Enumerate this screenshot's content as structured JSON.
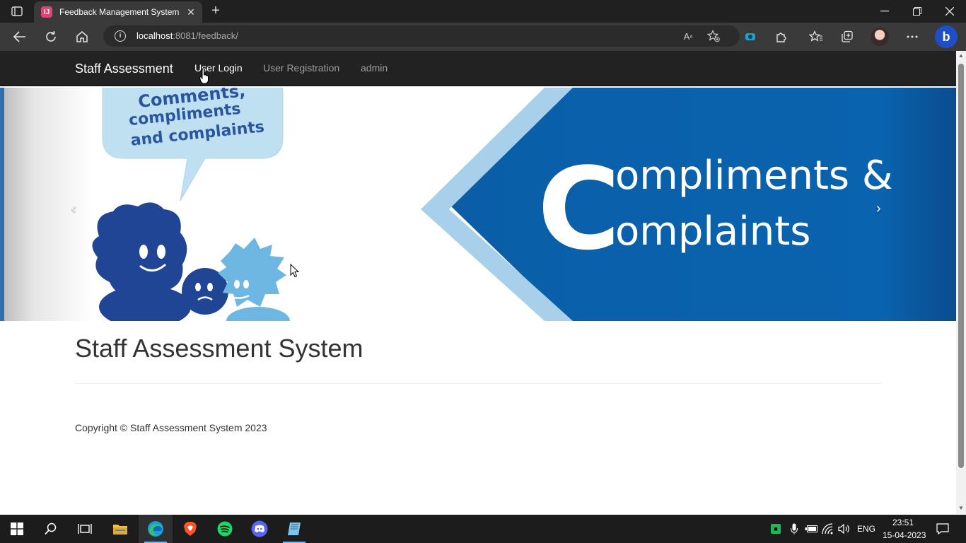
{
  "browser": {
    "tab_title": "Feedback Management System",
    "url_host": "localhost",
    "url_rest": ":8081/feedback/"
  },
  "navbar": {
    "brand": "Staff Assessment",
    "links": [
      "User Login",
      "User Registration",
      "admin"
    ]
  },
  "carousel": {
    "speech_bubble": [
      "Comments,",
      "compliments",
      "and complaints"
    ],
    "banner_line1": "ompliments &",
    "banner_line2": "omplaints",
    "banner_big_letter": "C",
    "prev_label": "‹",
    "next_label": "›"
  },
  "main": {
    "heading": "Staff Assessment System",
    "footer": "Copyright © Staff Assessment System 2023"
  },
  "taskbar": {
    "language": "ENG",
    "time": "23:51",
    "date": "15-04-2023"
  },
  "colors": {
    "navbar_bg": "#222222",
    "banner_blue": "#0a5ea8",
    "banner_light_blue": "#a9d0ea",
    "character_dark": "#1f4594",
    "character_light": "#6fb7e3",
    "taskbar_bg": "#1c1c1c"
  },
  "icons": [
    "tab-actions-icon",
    "close-icon",
    "plus-icon",
    "minimize-icon",
    "restore-icon",
    "back-icon",
    "refresh-icon",
    "home-icon",
    "info-icon",
    "read-aloud-icon",
    "favorite-add-icon",
    "extension-icon",
    "puzzle-icon",
    "favorites-icon",
    "collections-icon",
    "profile-avatar",
    "more-icon",
    "bing-icon",
    "windows-start-icon",
    "search-icon",
    "task-view-icon",
    "file-explorer-icon",
    "edge-icon",
    "brave-icon",
    "spotify-icon",
    "discord-icon",
    "app-icon",
    "mic-icon",
    "battery-icon",
    "wifi-icon",
    "volume-icon",
    "notification-icon"
  ]
}
